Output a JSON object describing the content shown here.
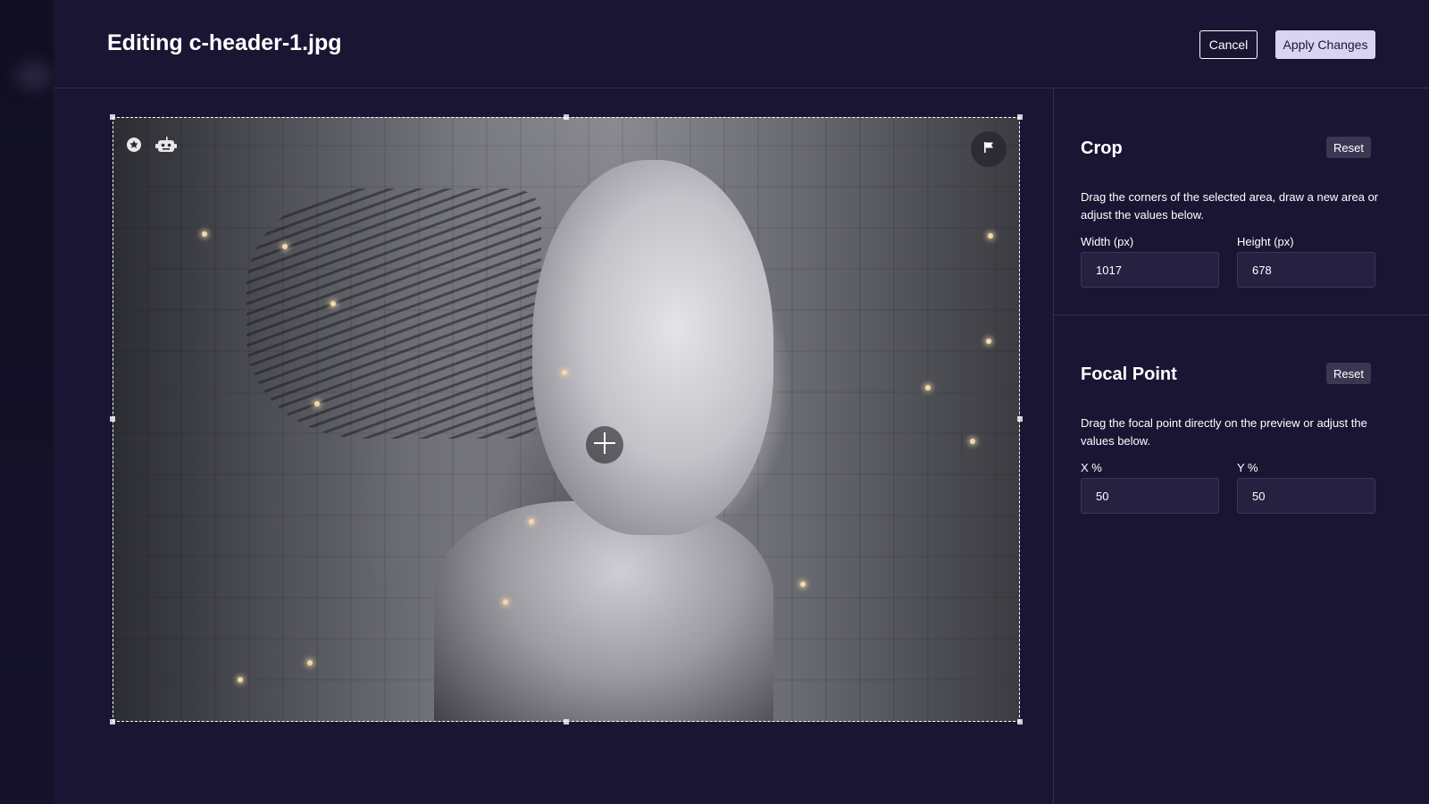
{
  "header": {
    "title": "Editing c-header-1.jpg",
    "cancel_label": "Cancel",
    "apply_label": "Apply Changes"
  },
  "image": {
    "alt": "Portrait of a humanoid robot woman with exposed cables and circuitry against a grey industrial background",
    "icons": [
      "star-badge-icon",
      "robot-icon",
      "flag-icon",
      "crosshair-icon"
    ]
  },
  "crop": {
    "heading": "Crop",
    "reset_label": "Reset",
    "description": "Drag the corners of the selected area, draw a new area or adjust the values below.",
    "width_label": "Width (px)",
    "width_value": "1017",
    "height_label": "Height (px)",
    "height_value": "678"
  },
  "focal": {
    "heading": "Focal Point",
    "reset_label": "Reset",
    "description": "Drag the focal point directly on the preview or adjust the values below.",
    "x_label": "X %",
    "x_value": "50",
    "y_label": "Y %",
    "y_value": "50"
  },
  "colors": {
    "background": "#1a1533",
    "border": "#34304d",
    "apply_button": "#d9d4f3",
    "reset_button": "#3b3752",
    "input_bg": "#262141"
  }
}
